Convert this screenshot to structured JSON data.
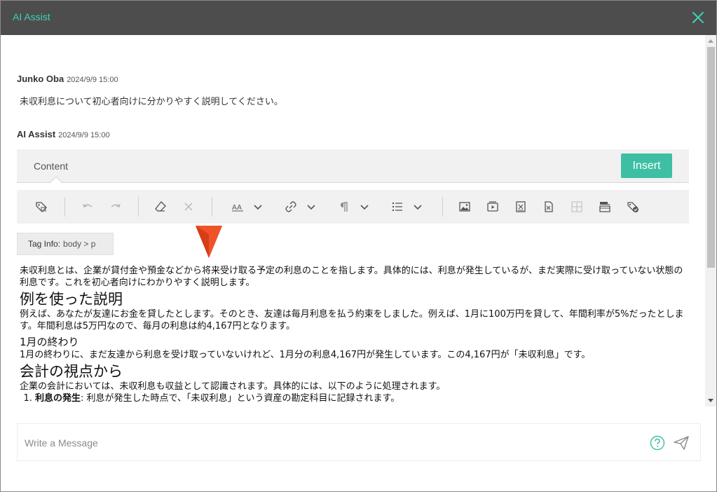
{
  "window": {
    "title": "AI Assist"
  },
  "colors": {
    "accent": "#3ebfa3",
    "title_text": "#3ed1b8",
    "titlebar": "#4d4d4d",
    "marker": "#f0522a"
  },
  "messages": {
    "user": {
      "name": "Junko Oba",
      "time": "2024/9/9 15:00",
      "text": "未収利息について初心者向けに分かりやすく説明してください。"
    },
    "assistant": {
      "name": "AI Assist",
      "time": "2024/9/9 15:00"
    }
  },
  "editor": {
    "tab_label": "Content",
    "insert_label": "Insert",
    "toolbar_icons": [
      "tag-icon",
      "undo-icon",
      "redo-icon",
      "eraser-icon",
      "clear-icon",
      "font-size-icon",
      "link-icon",
      "paragraph-icon",
      "list-icon",
      "image-icon",
      "video-icon",
      "insert-x-icon",
      "excel-icon",
      "table-icon",
      "layout-icon",
      "tag-check-icon"
    ],
    "tag_info": {
      "label": "Tag Info:",
      "path": "body  >  p"
    }
  },
  "document": {
    "intro": "未収利息とは、企業が貸付金や預金などから将来受け取る予定の利息のことを指します。具体的には、利息が発生しているが、まだ実際に受け取っていない状態の利息です。これを初心者向けにわかりやすく説明します。",
    "h1_example": "例を使った説明",
    "example": "例えば、あなたが友達にお金を貸したとします。そのとき、友達は毎月利息を払う約束をしました。例えば、1月に100万円を貸して、年間利率が5%だったとします。年間利息は5万円なので、毎月の利息は約4,167円となります。",
    "h3_end_jan": "1月の終わり",
    "end_jan": "1月の終わりに、まだ友達から利息を受け取っていないけれど、1月分の利息4,167円が発生しています。この4,167円が「未収利息」です。",
    "h1_accounting": "会計の視点から",
    "accounting": "企業の会計においては、未収利息も収益として認識されます。具体的には、以下のように処理されます。",
    "list": [
      {
        "bold": "利息の発生",
        "text": ": 利息が発生した時点で、「未収利息」という資産の勘定科目に記録されます。"
      }
    ]
  },
  "composer": {
    "placeholder": "Write a Message"
  }
}
